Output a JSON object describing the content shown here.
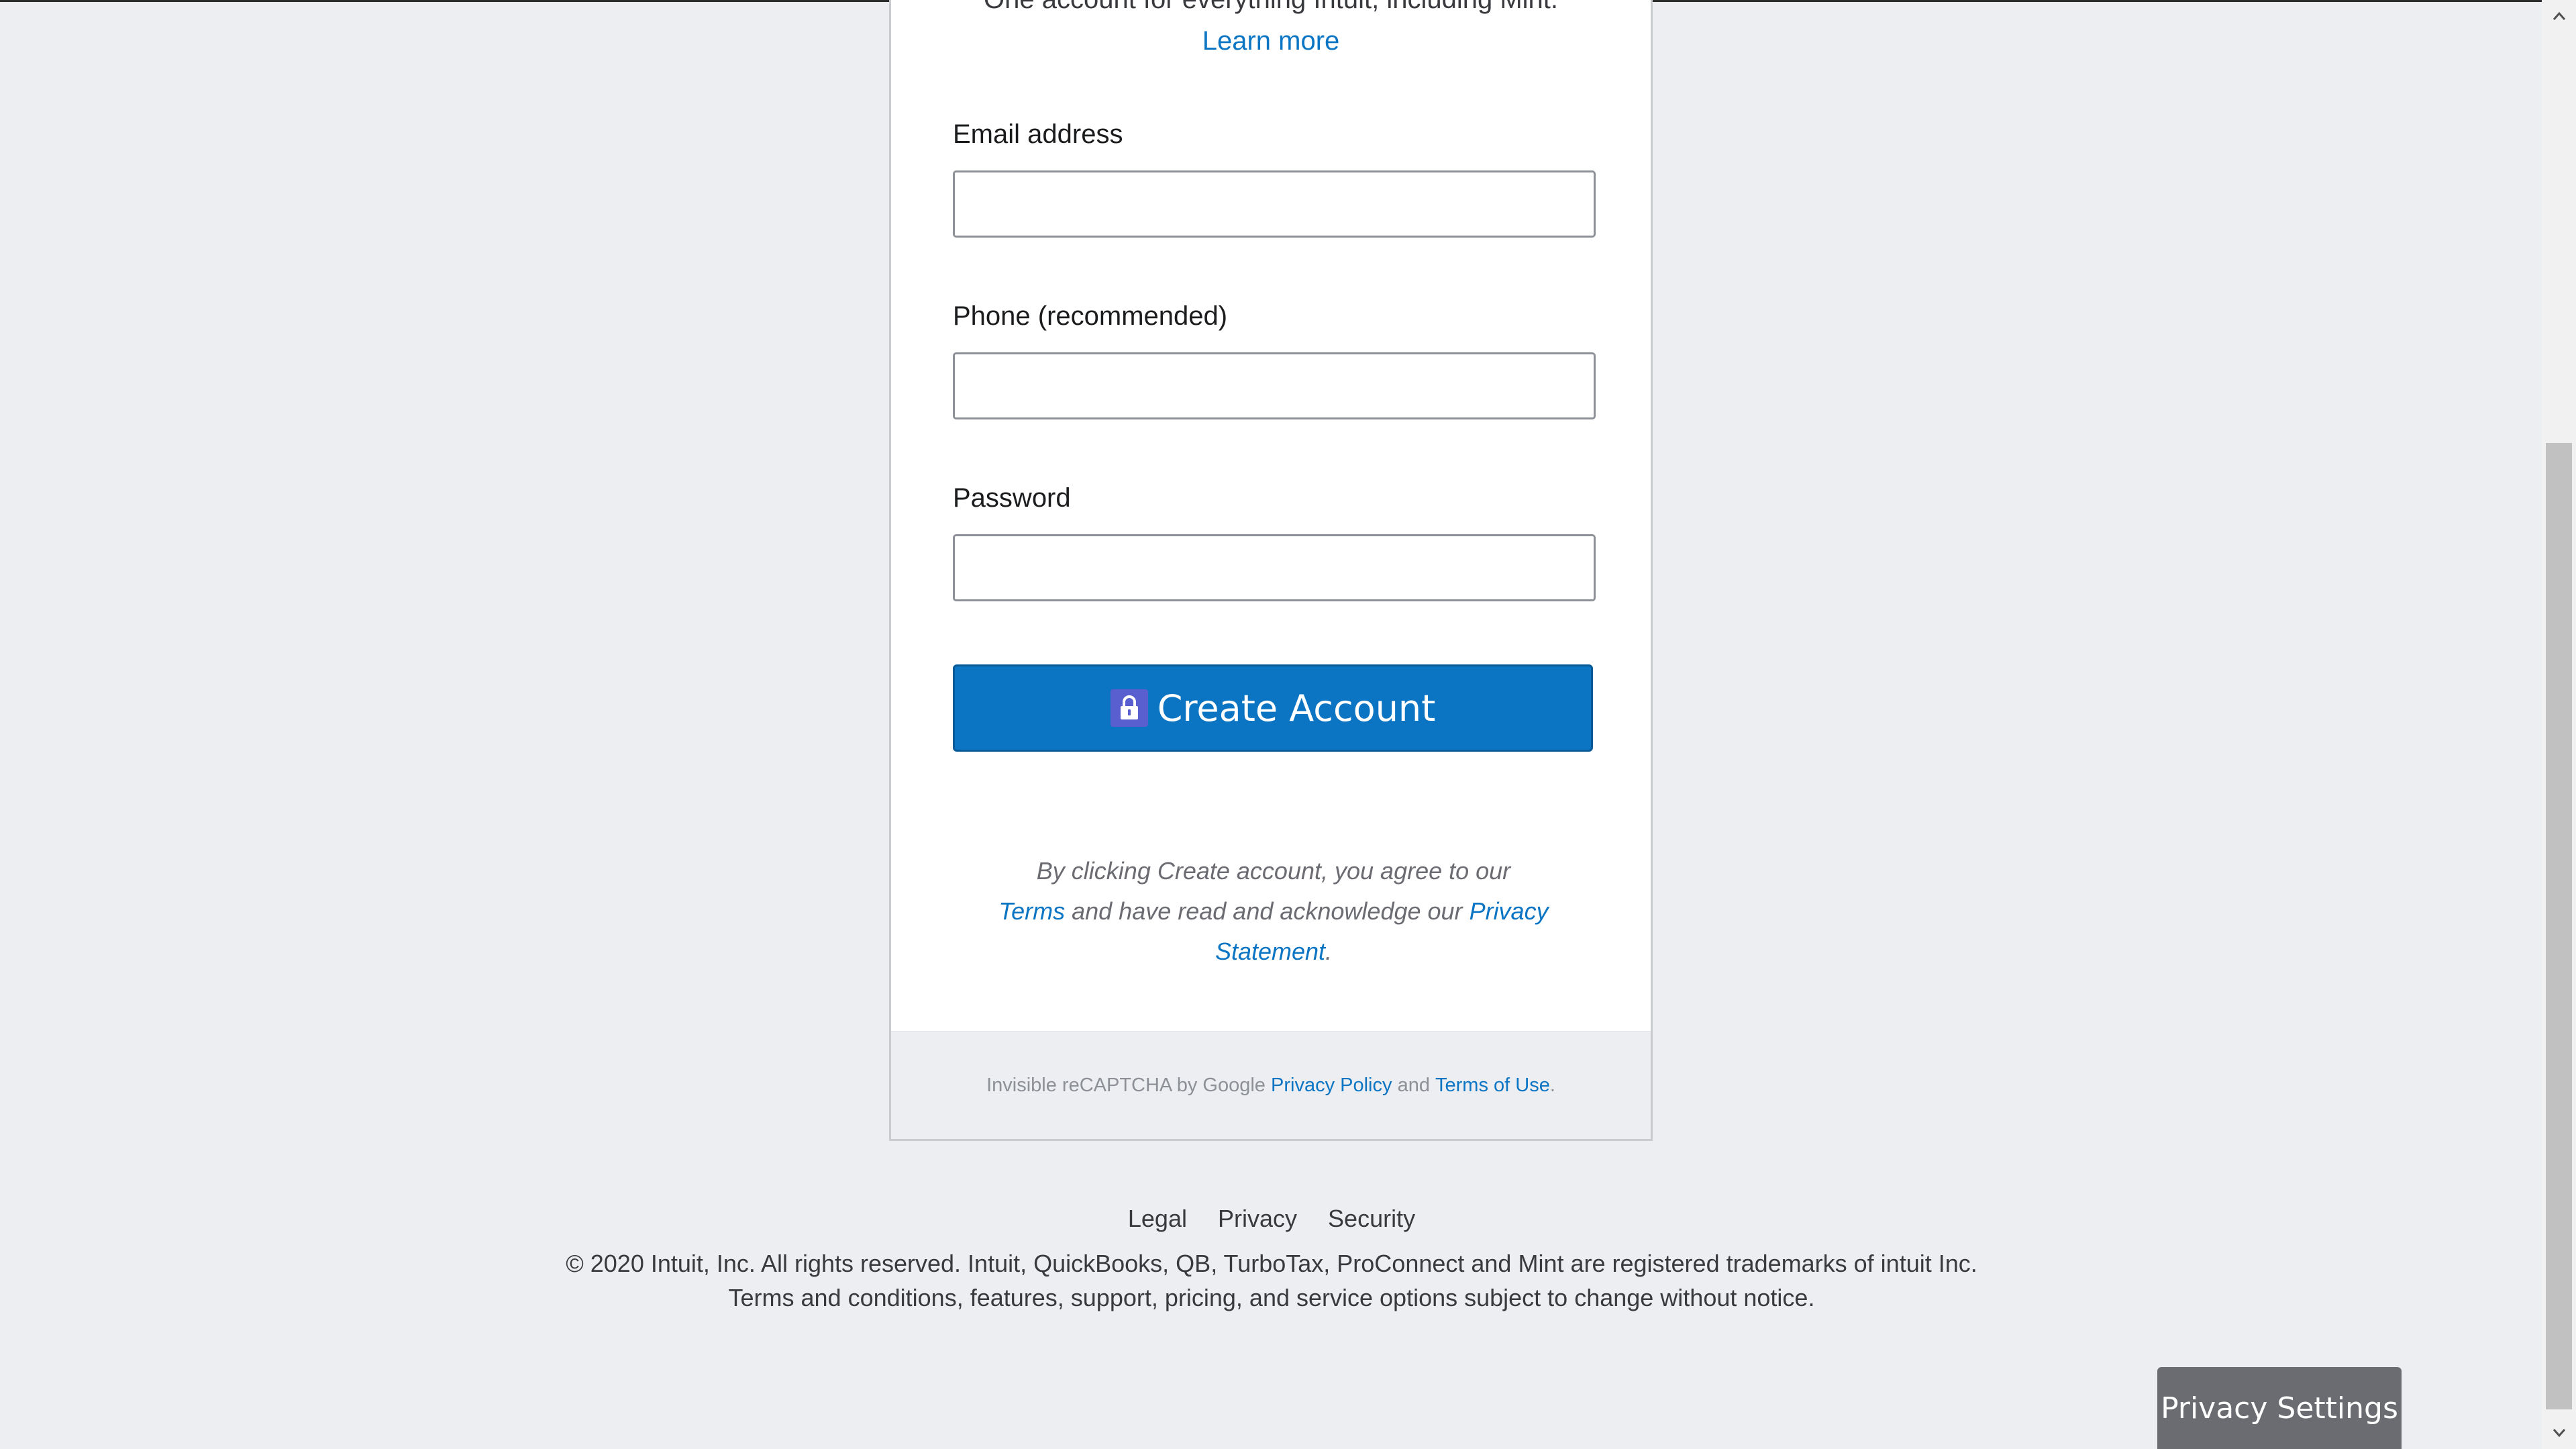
{
  "header": {
    "tagline": "One account for everything Intuit, including Mint.",
    "learn_more": "Learn more"
  },
  "form": {
    "email_label": "Email address",
    "email_value": "",
    "phone_label": "Phone (recommended)",
    "phone_value": "",
    "password_label": "Password",
    "password_value": "",
    "create_button": "Create Account",
    "create_button_icon": "lock-icon"
  },
  "agreement": {
    "text1": "By clicking Create account, you agree to our",
    "terms_link": "Terms",
    "text2": "and have read and acknowledge our",
    "privacy_link_1": "Privacy",
    "privacy_link_2": "Statement",
    "period": "."
  },
  "captcha": {
    "text1": "Invisible reCAPTCHA by Google",
    "privacy_policy": "Privacy Policy",
    "and": "and",
    "terms_of_use": "Terms of Use",
    "period": "."
  },
  "footer": {
    "links": [
      "Legal",
      "Privacy",
      "Security"
    ],
    "copyright": "© 2020 Intuit, Inc. All rights reserved. Intuit, QuickBooks, QB, TurboTax, ProConnect and Mint are registered trademarks of intuit Inc.",
    "disclaimer": "Terms and conditions, features, support, pricing, and service options subject to change without notice."
  },
  "privacy_settings": "Privacy Settings",
  "colors": {
    "accent": "#0b75c4",
    "page_background": "#eceef1",
    "button_border": "#075a98",
    "privacy_button": "#6b6c72"
  }
}
